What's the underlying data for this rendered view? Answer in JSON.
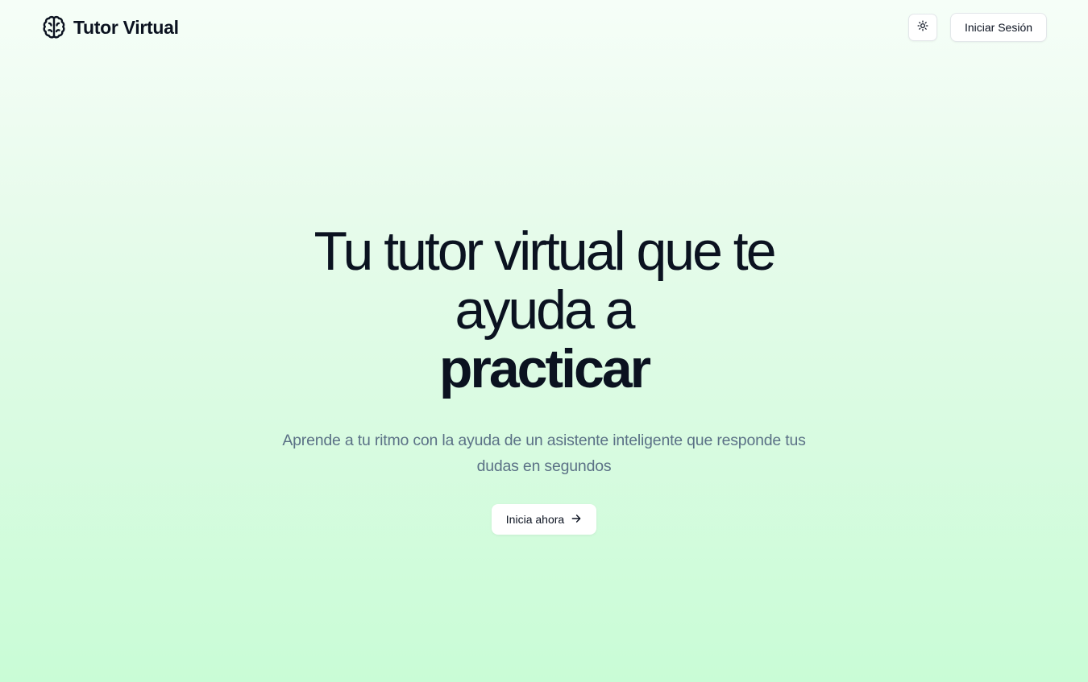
{
  "header": {
    "brand_name": "Tutor Virtual",
    "brand_icon": "brain-icon",
    "theme_toggle_icon": "sun-icon",
    "login_label": "Iniciar Sesión"
  },
  "hero": {
    "title_line1": "Tu tutor virtual que te ayuda a",
    "title_emphasis": "practicar",
    "subtitle": "Aprende a tu ritmo con la ayuda de un asistente inteligente que responde tus dudas en segundos",
    "cta_label": "Inicia ahora",
    "cta_icon": "arrow-right-icon"
  },
  "colors": {
    "text_primary": "#0b1220",
    "text_secondary": "#5b7186",
    "background_top": "#f6fef8",
    "background_bottom": "#c9fcd6",
    "button_bg": "#ffffff"
  }
}
